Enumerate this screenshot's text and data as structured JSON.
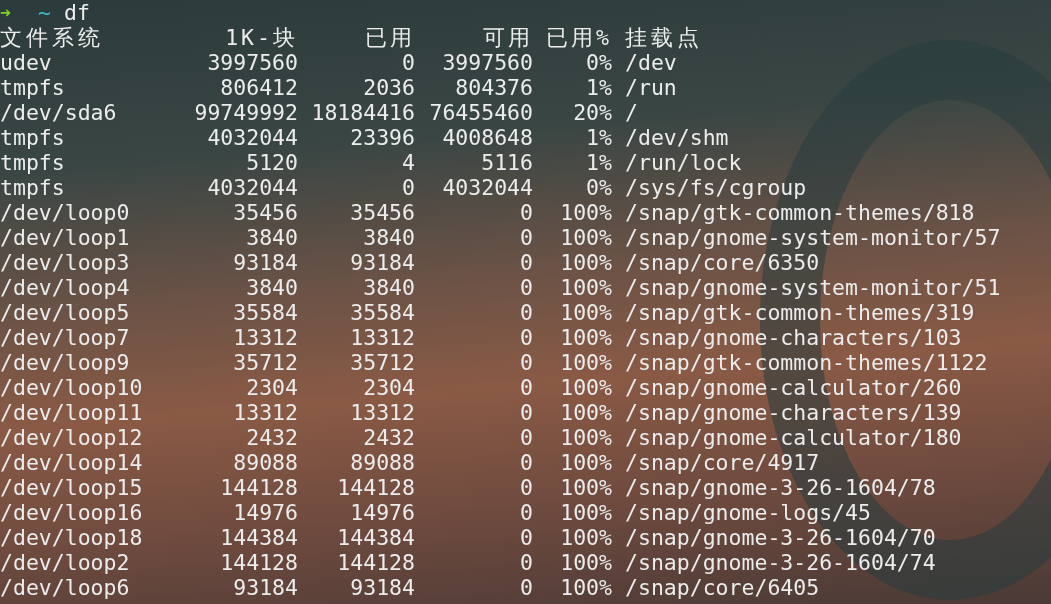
{
  "prompt": {
    "arrow": "➜",
    "directory": "~",
    "command": "df"
  },
  "columns": [
    "文件系统",
    "1K-块",
    "已用",
    "可用",
    "已用%",
    "挂载点"
  ],
  "rows": [
    {
      "filesystem": "udev",
      "size": "3997560",
      "used": "0",
      "available": "3997560",
      "use_percent": "0%",
      "mounted_on": "/dev"
    },
    {
      "filesystem": "tmpfs",
      "size": "806412",
      "used": "2036",
      "available": "804376",
      "use_percent": "1%",
      "mounted_on": "/run"
    },
    {
      "filesystem": "/dev/sda6",
      "size": "99749992",
      "used": "18184416",
      "available": "76455460",
      "use_percent": "20%",
      "mounted_on": "/"
    },
    {
      "filesystem": "tmpfs",
      "size": "4032044",
      "used": "23396",
      "available": "4008648",
      "use_percent": "1%",
      "mounted_on": "/dev/shm"
    },
    {
      "filesystem": "tmpfs",
      "size": "5120",
      "used": "4",
      "available": "5116",
      "use_percent": "1%",
      "mounted_on": "/run/lock"
    },
    {
      "filesystem": "tmpfs",
      "size": "4032044",
      "used": "0",
      "available": "4032044",
      "use_percent": "0%",
      "mounted_on": "/sys/fs/cgroup"
    },
    {
      "filesystem": "/dev/loop0",
      "size": "35456",
      "used": "35456",
      "available": "0",
      "use_percent": "100%",
      "mounted_on": "/snap/gtk-common-themes/818"
    },
    {
      "filesystem": "/dev/loop1",
      "size": "3840",
      "used": "3840",
      "available": "0",
      "use_percent": "100%",
      "mounted_on": "/snap/gnome-system-monitor/57"
    },
    {
      "filesystem": "/dev/loop3",
      "size": "93184",
      "used": "93184",
      "available": "0",
      "use_percent": "100%",
      "mounted_on": "/snap/core/6350"
    },
    {
      "filesystem": "/dev/loop4",
      "size": "3840",
      "used": "3840",
      "available": "0",
      "use_percent": "100%",
      "mounted_on": "/snap/gnome-system-monitor/51"
    },
    {
      "filesystem": "/dev/loop5",
      "size": "35584",
      "used": "35584",
      "available": "0",
      "use_percent": "100%",
      "mounted_on": "/snap/gtk-common-themes/319"
    },
    {
      "filesystem": "/dev/loop7",
      "size": "13312",
      "used": "13312",
      "available": "0",
      "use_percent": "100%",
      "mounted_on": "/snap/gnome-characters/103"
    },
    {
      "filesystem": "/dev/loop9",
      "size": "35712",
      "used": "35712",
      "available": "0",
      "use_percent": "100%",
      "mounted_on": "/snap/gtk-common-themes/1122"
    },
    {
      "filesystem": "/dev/loop10",
      "size": "2304",
      "used": "2304",
      "available": "0",
      "use_percent": "100%",
      "mounted_on": "/snap/gnome-calculator/260"
    },
    {
      "filesystem": "/dev/loop11",
      "size": "13312",
      "used": "13312",
      "available": "0",
      "use_percent": "100%",
      "mounted_on": "/snap/gnome-characters/139"
    },
    {
      "filesystem": "/dev/loop12",
      "size": "2432",
      "used": "2432",
      "available": "0",
      "use_percent": "100%",
      "mounted_on": "/snap/gnome-calculator/180"
    },
    {
      "filesystem": "/dev/loop14",
      "size": "89088",
      "used": "89088",
      "available": "0",
      "use_percent": "100%",
      "mounted_on": "/snap/core/4917"
    },
    {
      "filesystem": "/dev/loop15",
      "size": "144128",
      "used": "144128",
      "available": "0",
      "use_percent": "100%",
      "mounted_on": "/snap/gnome-3-26-1604/78"
    },
    {
      "filesystem": "/dev/loop16",
      "size": "14976",
      "used": "14976",
      "available": "0",
      "use_percent": "100%",
      "mounted_on": "/snap/gnome-logs/45"
    },
    {
      "filesystem": "/dev/loop18",
      "size": "144384",
      "used": "144384",
      "available": "0",
      "use_percent": "100%",
      "mounted_on": "/snap/gnome-3-26-1604/70"
    },
    {
      "filesystem": "/dev/loop2",
      "size": "144128",
      "used": "144128",
      "available": "0",
      "use_percent": "100%",
      "mounted_on": "/snap/gnome-3-26-1604/74"
    },
    {
      "filesystem": "/dev/loop6",
      "size": "93184",
      "used": "93184",
      "available": "0",
      "use_percent": "100%",
      "mounted_on": "/snap/core/6405"
    }
  ]
}
